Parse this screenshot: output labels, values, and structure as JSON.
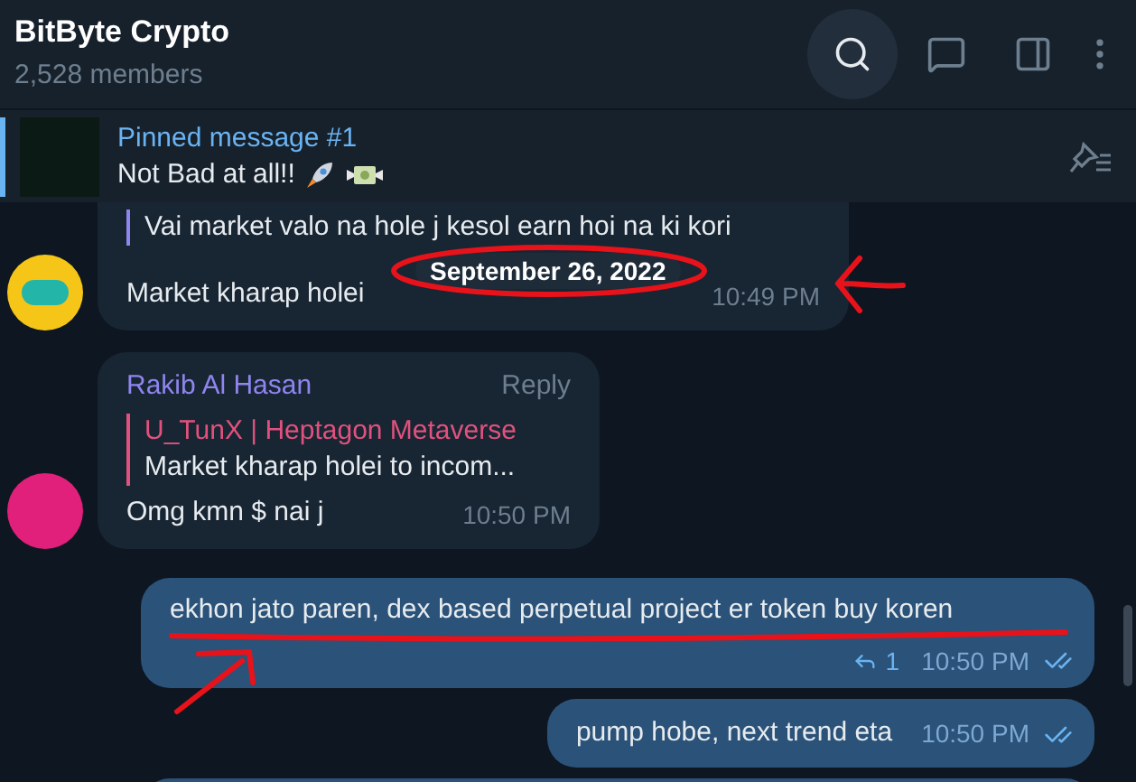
{
  "header": {
    "title": "BitByte Crypto",
    "subtitle": "2,528 members"
  },
  "pinned": {
    "label": "Pinned message #1",
    "text": "Not Bad at all!!"
  },
  "date_badge": "September 26, 2022",
  "messages": [
    {
      "kind": "incoming",
      "quote": {
        "text": "Vai market valo na hole j kesol earn hoi na ki kori"
      },
      "text": "Market kharap holei",
      "time": "10:49 PM"
    },
    {
      "kind": "incoming",
      "sender": "Rakib Al Hasan",
      "action": "Reply",
      "quote": {
        "author": "U_TunX | Heptagon Metaverse",
        "text": "Market kharap holei to incom..."
      },
      "text": "Omg kmn $ nai j",
      "time": "10:50 PM"
    },
    {
      "kind": "outgoing",
      "text": "ekhon jato paren, dex based perpetual project er token buy koren",
      "replies": "1",
      "time": "10:50 PM",
      "read": true
    },
    {
      "kind": "outgoing",
      "text": "pump hobe, next trend eta",
      "time": "10:50 PM",
      "read": true
    },
    {
      "kind": "outgoing_partial"
    }
  ]
}
